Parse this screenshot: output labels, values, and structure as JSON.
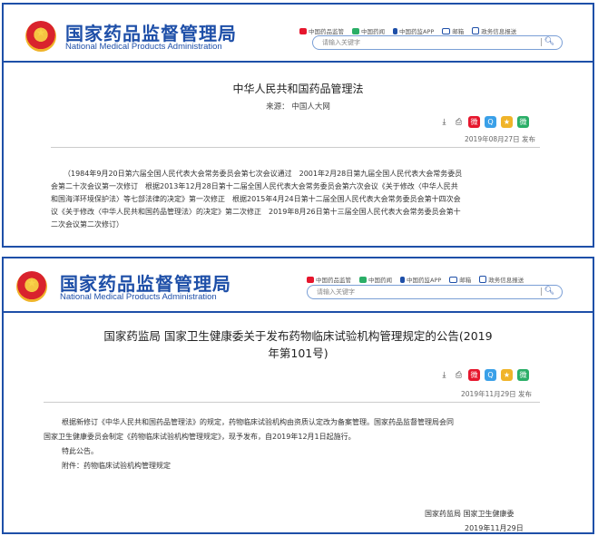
{
  "site": {
    "name_cn": "国家药品监督管理局",
    "name_en": "National Medical Products Administration"
  },
  "toplinks": [
    {
      "label": "中国药品监管",
      "icon": "weibo-icon",
      "color": "#e6162d"
    },
    {
      "label": "中国药闻",
      "icon": "wechat-icon",
      "color": "#2aae67"
    },
    {
      "label": "中国药监APP",
      "icon": "mobile-icon",
      "color": "#1e4fa8"
    },
    {
      "label": "邮箱",
      "icon": "mail-icon",
      "color": "#1e4fa8"
    },
    {
      "label": "政务信息报送",
      "icon": "report-icon",
      "color": "#1e4fa8"
    }
  ],
  "search": {
    "placeholder": "请输入关键字"
  },
  "article1": {
    "title": "中华人民共和国药品管理法",
    "source": "来源： 中国人大网",
    "date": "2019年08月27日 发布",
    "body_lines": [
      "（1984年9月20日第六届全国人民代表大会常务委员会第七次会议通过　2001年2月28日第九届全国人民代表大会常务委员",
      "会第二十次会议第一次修订　根据2013年12月28日第十二届全国人民代表大会常务委员会第六次会议《关于修改〈中华人民共",
      "和国海洋环境保护法〉等七部法律的决定》第一次修正　根据2015年4月24日第十二届全国人民代表大会常务委员会第十四次会",
      "议《关于修改〈中华人民共和国药品管理法〉的决定》第二次修正　2019年8月26日第十三届全国人民代表大会常务委员会第十",
      "二次会议第二次修订）"
    ]
  },
  "article2": {
    "title_line1": "国家药监局 国家卫生健康委关于发布药物临床试验机构管理规定的公告(2019",
    "title_line2": "年第101号)",
    "date": "2019年11月29日 发布",
    "body_lines": [
      "根据新修订《中华人民共和国药品管理法》的规定，药物临床试验机构由资质认定改为备案管理。国家药品监督管理局会同",
      "国家卫生健康委员会制定《药物临床试验机构管理规定》，现予发布，自2019年12月1日起施行。",
      "特此公告。",
      "附件：药物临床试验机构管理规定"
    ],
    "signature": "国家药监局 国家卫生健康委",
    "signature_date": "2019年11月29日"
  },
  "share_icons": [
    {
      "name": "weibo-share-icon",
      "color": "#e6162d",
      "glyph": "微"
    },
    {
      "name": "qzone-share-icon",
      "color": "#3aa0e8",
      "glyph": "Q"
    },
    {
      "name": "star-share-icon",
      "color": "#f0b429",
      "glyph": "★"
    },
    {
      "name": "wechat-share-icon",
      "color": "#2aae67",
      "glyph": "微"
    }
  ]
}
